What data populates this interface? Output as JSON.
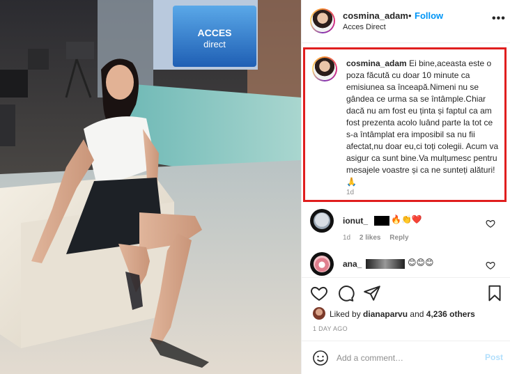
{
  "header": {
    "username": "cosmina_adam",
    "separator": "•",
    "follow_label": "Follow",
    "location": "Acces Direct",
    "more_glyph": "•••"
  },
  "photo": {
    "studio_sign_line1": "ACCES",
    "studio_sign_line2": "direct"
  },
  "caption": {
    "username": "cosmina_adam",
    "text": "Ei bine,aceasta este o poza făcută cu doar 10 minute ca emisiunea sa înceapă.Nimeni nu se gândea ce urma sa se întâmple.Chiar dacă nu am fost eu ținta și faptul ca am fost prezenta acolo luând parte la tot ce s-a întâmplat era imposibil sa nu fii afectat,nu doar eu,ci toți colegii. Acum va asigur ca sunt bine.Va mulțumesc pentru mesajele voastre și ca ne sunteți alături!🙏",
    "time": "1d",
    "highlight_color": "#e01e1e"
  },
  "comments": [
    {
      "username": "ionut_",
      "emojis": "🔥👏❤️",
      "time": "1d",
      "likes": "2 likes",
      "reply": "Reply",
      "avatar_icon": "avatar-icon"
    },
    {
      "username": "ana_",
      "emojis": "😊😊😊",
      "avatar_icon": "avatar-icon"
    }
  ],
  "actions": {
    "icons": [
      "heart-icon",
      "comment-icon",
      "share-icon",
      "bookmark-icon"
    ]
  },
  "likes": {
    "prefix": "Liked by ",
    "user": "dianaparvu",
    "middle": " and ",
    "count": "4,236 others"
  },
  "post_date": "1 DAY AGO",
  "add_comment": {
    "placeholder": "Add a comment…",
    "post_label": "Post"
  },
  "colors": {
    "link_blue": "#0095f6",
    "post_disabled": "#b2dffc",
    "muted": "#8e8e8e",
    "text": "#262626"
  }
}
